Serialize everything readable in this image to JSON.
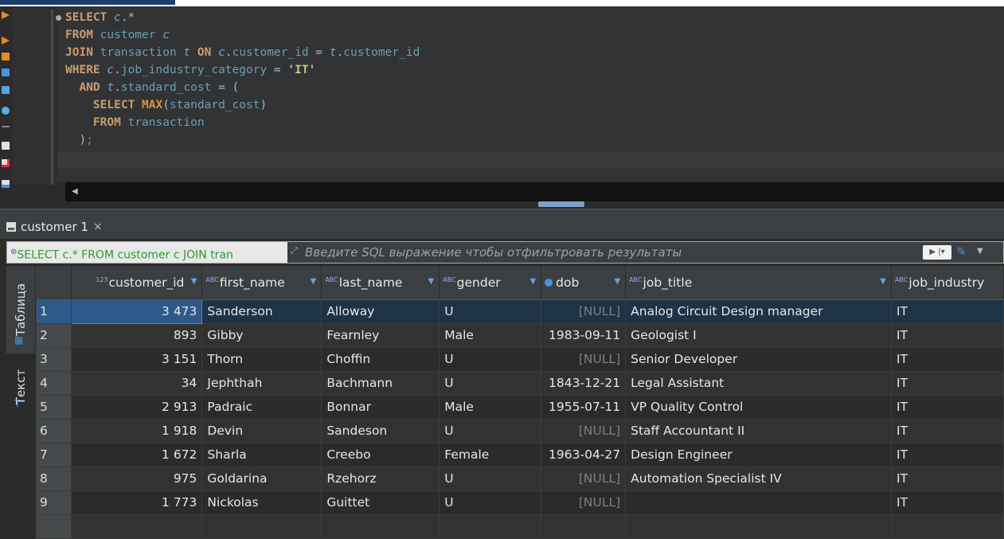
{
  "editor": {
    "lines": [
      {
        "parts": [
          [
            "kw",
            "SELECT "
          ],
          [
            "al",
            "c"
          ],
          [
            "op",
            ".*"
          ]
        ]
      },
      {
        "parts": [
          [
            "kw",
            "FROM "
          ],
          [
            "id",
            "customer "
          ],
          [
            "al",
            "c"
          ]
        ]
      },
      {
        "parts": [
          [
            "kw",
            "JOIN "
          ],
          [
            "id",
            "transaction "
          ],
          [
            "al",
            "t "
          ],
          [
            "kw",
            "ON "
          ],
          [
            "al",
            "c"
          ],
          [
            "op",
            "."
          ],
          [
            "id",
            "customer_id "
          ],
          [
            "op",
            "= "
          ],
          [
            "al",
            "t"
          ],
          [
            "op",
            "."
          ],
          [
            "id",
            "customer_id"
          ]
        ]
      },
      {
        "parts": [
          [
            "kw",
            "WHERE "
          ],
          [
            "al",
            "c"
          ],
          [
            "op",
            "."
          ],
          [
            "id",
            "job_industry_category "
          ],
          [
            "op",
            "= "
          ],
          [
            "str",
            "'IT'"
          ]
        ]
      },
      {
        "parts": [
          [
            "op",
            "  "
          ],
          [
            "kw",
            "AND "
          ],
          [
            "al",
            "t"
          ],
          [
            "op",
            "."
          ],
          [
            "id",
            "standard_cost "
          ],
          [
            "op",
            "= ("
          ]
        ]
      },
      {
        "parts": [
          [
            "op",
            "    "
          ],
          [
            "kw",
            "SELECT "
          ],
          [
            "fn",
            "MAX"
          ],
          [
            "op",
            "("
          ],
          [
            "id",
            "standard_cost"
          ],
          [
            "op",
            ")"
          ]
        ]
      },
      {
        "parts": [
          [
            "op",
            "    "
          ],
          [
            "kw",
            "FROM "
          ],
          [
            "id",
            "transaction"
          ]
        ]
      },
      {
        "parts": [
          [
            "op",
            "  )"
          ],
          [
            "pn",
            ";"
          ]
        ]
      }
    ]
  },
  "tab": {
    "label": "customer 1",
    "close": "×"
  },
  "filter": {
    "sql_preview": "SELECT c.* FROM customer c JOIN tran",
    "placeholder": "Введите SQL выражение чтобы отфильтровать результаты"
  },
  "side_tabs": {
    "table": "Таблица",
    "text": "Текст"
  },
  "columns": [
    "customer_id",
    "first_name",
    "last_name",
    "gender",
    "dob",
    "job_title",
    "job_industry"
  ],
  "rows": [
    {
      "n": "1",
      "customer_id": "3 473",
      "first_name": "Sanderson",
      "last_name": "Alloway",
      "gender": "U",
      "dob": "[NULL]",
      "job_title": "Analog Circuit Design manager",
      "job_industry": "IT"
    },
    {
      "n": "2",
      "customer_id": "893",
      "first_name": "Gibby",
      "last_name": "Fearnley",
      "gender": "Male",
      "dob": "1983-09-11",
      "job_title": "Geologist I",
      "job_industry": "IT"
    },
    {
      "n": "3",
      "customer_id": "3 151",
      "first_name": "Thorn",
      "last_name": "Choffin",
      "gender": "U",
      "dob": "[NULL]",
      "job_title": "Senior Developer",
      "job_industry": "IT"
    },
    {
      "n": "4",
      "customer_id": "34",
      "first_name": "Jephthah",
      "last_name": "Bachmann",
      "gender": "U",
      "dob": "1843-12-21",
      "job_title": "Legal Assistant",
      "job_industry": "IT"
    },
    {
      "n": "5",
      "customer_id": "2 913",
      "first_name": "Padraic",
      "last_name": "Bonnar",
      "gender": "Male",
      "dob": "1955-07-11",
      "job_title": "VP Quality Control",
      "job_industry": "IT"
    },
    {
      "n": "6",
      "customer_id": "1 918",
      "first_name": "Devin",
      "last_name": "Sandeson",
      "gender": "U",
      "dob": "[NULL]",
      "job_title": "Staff Accountant II",
      "job_industry": "IT"
    },
    {
      "n": "7",
      "customer_id": "1 672",
      "first_name": "Sharla",
      "last_name": "Creebo",
      "gender": "Female",
      "dob": "1963-04-27",
      "job_title": "Design Engineer",
      "job_industry": "IT"
    },
    {
      "n": "8",
      "customer_id": "975",
      "first_name": "Goldarina",
      "last_name": "Rzehorz",
      "gender": "U",
      "dob": "[NULL]",
      "job_title": "Automation Specialist IV",
      "job_industry": "IT"
    },
    {
      "n": "9",
      "customer_id": "1 773",
      "first_name": "Nickolas",
      "last_name": "Guittet",
      "gender": "U",
      "dob": "[NULL]",
      "job_title": "",
      "job_industry": "IT"
    }
  ]
}
